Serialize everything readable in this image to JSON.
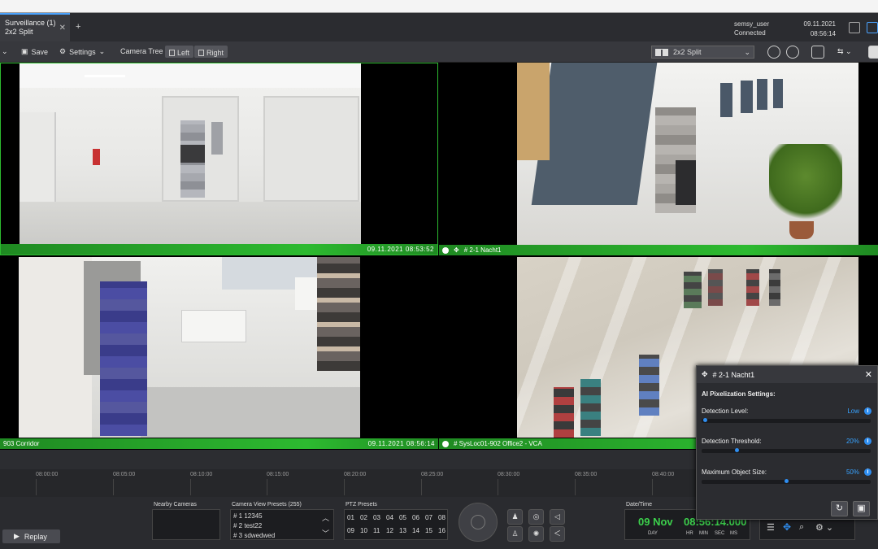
{
  "tab": {
    "title": "Surveillance (1)",
    "subtitle": "2x2 Split",
    "close": "✕",
    "add": "+"
  },
  "user": {
    "name": "semsy_user",
    "status": "Connected",
    "date": "09.11.2021",
    "time": "08:56:14"
  },
  "toolbar": {
    "save": "Save",
    "settings": "Settings",
    "camera_tree": "Camera Tree",
    "left": "Left",
    "right": "Right",
    "layout": "2x2 Split"
  },
  "cells": [
    {
      "label": "",
      "timestamp": "09.11.2021  08:53:52"
    },
    {
      "label": "# 2-1  Nacht1",
      "timestamp": ""
    },
    {
      "label": "903  Corridor",
      "timestamp": "09.11.2021  08:56:14"
    },
    {
      "label": "# SysLoc01-902  Office2 - VCA",
      "timestamp": ""
    }
  ],
  "timeline": {
    "ticks": [
      "08:00:00",
      "08:05:00",
      "08:10:00",
      "08:15:00",
      "08:20:00",
      "08:25:00",
      "08:30:00",
      "08:35:00",
      "08:40:00"
    ]
  },
  "bottom": {
    "nearby_label": "Nearby Cameras",
    "presets_label": "Camera View Presets (255)",
    "presets": [
      "# 1  12345",
      "# 2  test22",
      "# 3  sdwedwed"
    ],
    "ptz_label": "PTZ Presets",
    "ptz": [
      "01",
      "02",
      "03",
      "04",
      "05",
      "06",
      "07",
      "08",
      "09",
      "10",
      "11",
      "12",
      "13",
      "14",
      "15",
      "16"
    ],
    "replay": "Replay",
    "datetime_label": "Date/Time",
    "day": "09 Nov",
    "day_sub": "DAY",
    "clock": "08:56:14.000",
    "clock_sub": [
      "HR",
      "MIN",
      "SEC",
      "MS"
    ]
  },
  "pix_panel": {
    "camera": "# 2-1  Nacht1",
    "close": "✕",
    "title": "AI Pixelization Settings:",
    "settings": [
      {
        "label": "Detection Level:",
        "value": "Low",
        "level": 0.01
      },
      {
        "label": "Detection Threshold:",
        "value": "20%",
        "level": 0.2
      },
      {
        "label": "Maximum Object Size:",
        "value": "50%",
        "level": 0.5
      }
    ],
    "info": "i"
  },
  "colors": {
    "accent": "#2f8ef0",
    "green_bar": "#2dba30",
    "clock_green": "#3cd04c"
  }
}
